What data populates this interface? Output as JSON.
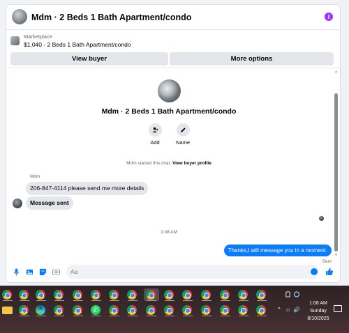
{
  "header": {
    "title": "Mdm · 2 Beds 1 Bath Apartment/condo",
    "info_icon": "i"
  },
  "listing": {
    "marketplace_label": "Marketplace",
    "price_title": "$1,040 - 2 Beds 1 Bath Apartment/condo",
    "view_buyer_label": "View buyer",
    "more_options_label": "More options"
  },
  "conversation": {
    "title": "Mdm · 2 Beds 1 Bath Apartment/condo",
    "actions": [
      {
        "label": "Add",
        "icon": "add-person-icon"
      },
      {
        "label": "Name",
        "icon": "pencil-icon"
      }
    ],
    "system_message": "Mdm started this chat.",
    "system_link": "View buyer profile",
    "sender_name": "Mdm",
    "incoming": [
      "206-847-4114 please send me more details",
      "Message sent"
    ],
    "timestamp": "1:08 AM",
    "outgoing": "Thanks,I will message you in a moment.",
    "status": "Sent"
  },
  "composer": {
    "placeholder": "Aa"
  },
  "taskbar": {
    "time": "1:08 AM",
    "day": "Sunday",
    "date": "8/10/2025",
    "tray_symbols": [
      "^",
      "⌂",
      "🔊"
    ]
  },
  "colors": {
    "accent_blue": "#0a7cff",
    "info_purple": "#a033ff",
    "bubble_gray": "#e4e6eb"
  }
}
